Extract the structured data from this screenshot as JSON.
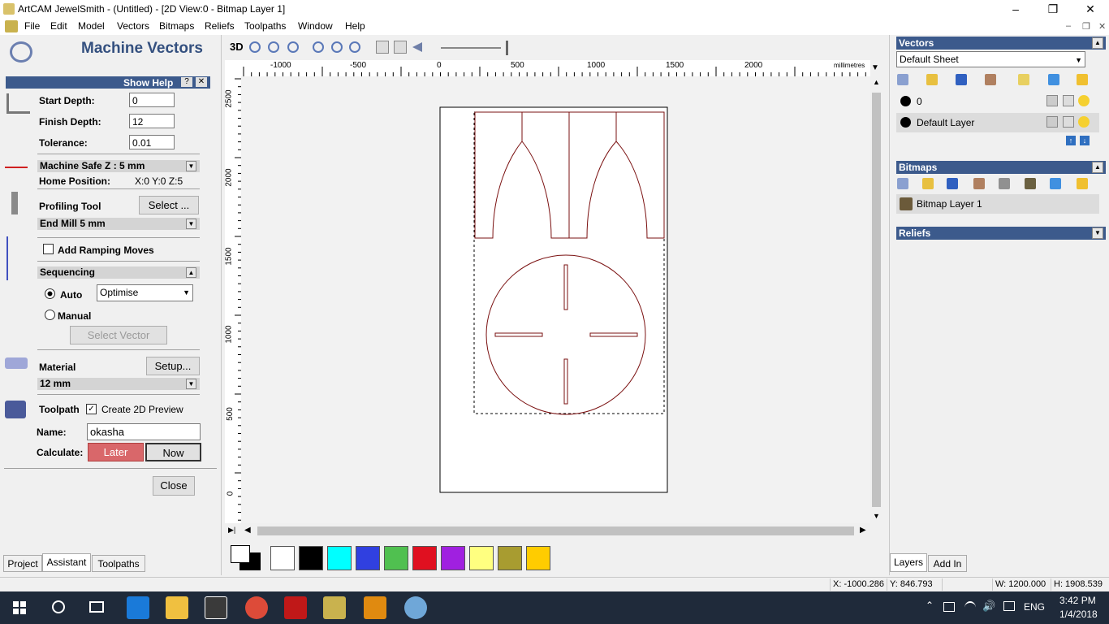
{
  "window": {
    "title": "ArtCAM JewelSmith - (Untitled) - [2D View:0 - Bitmap Layer 1]"
  },
  "menu": [
    "File",
    "Edit",
    "Model",
    "Vectors",
    "Bitmaps",
    "Reliefs",
    "Toolpaths",
    "Window",
    "Help"
  ],
  "left": {
    "title": "Machine Vectors",
    "show_help": "Show Help",
    "help_q": "?",
    "start_depth_label": "Start Depth:",
    "start_depth": "0",
    "finish_depth_label": "Finish Depth:",
    "finish_depth": "12",
    "tolerance_label": "Tolerance:",
    "tolerance": "0.01",
    "safe_z": "Machine Safe Z : 5 mm",
    "home_label": "Home Position:",
    "home_value": "X:0 Y:0 Z:5",
    "profiling_tool_label": "Profiling Tool",
    "select_button": "Select ...",
    "tool_name": "End Mill 5 mm",
    "ramping_label": "Add Ramping Moves",
    "sequencing": "Sequencing",
    "auto_label": "Auto",
    "auto_option": "Optimise",
    "manual_label": "Manual",
    "select_vector": "Select Vector",
    "material_label": "Material",
    "setup_button": "Setup...",
    "material_value": "12 mm",
    "toolpath_label": "Toolpath",
    "preview_label": "Create 2D Preview",
    "name_label": "Name:",
    "name_value": "okasha",
    "calculate_label": "Calculate:",
    "later_button": "Later",
    "now_button": "Now",
    "close_button": "Close",
    "tabs": [
      "Project",
      "Assistant",
      "Toolpaths"
    ]
  },
  "view": {
    "toolbar_3d": "3D",
    "ruler_top": [
      "-1000",
      "-500",
      "0",
      "500",
      "1000",
      "1500",
      "2000"
    ],
    "ruler_unit": "millimetres",
    "ruler_left": [
      "2500",
      "2000",
      "1500",
      "1000",
      "500",
      "0"
    ]
  },
  "palette": [
    "#ffffff",
    "#000000",
    "#00ffff",
    "#3040e0",
    "#50c050",
    "#e01020",
    "#a020e0",
    "#ffff80",
    "#a89c30",
    "#ffcc00"
  ],
  "right": {
    "vectors_header": "Vectors",
    "sheet": "Default Sheet",
    "layers": [
      "0",
      "Default Layer"
    ],
    "bitmaps_header": "Bitmaps",
    "bitmap_layer": "Bitmap Layer 1",
    "reliefs_header": "Reliefs",
    "tabs": [
      "Layers",
      "Add In"
    ]
  },
  "status": {
    "x": "X: -1000.286",
    "y": "Y: 846.793",
    "w": "W: 1200.000",
    "h": "H: 1908.539"
  },
  "taskbar": {
    "time": "3:42 PM",
    "date": "1/4/2018",
    "lang": "ENG"
  }
}
